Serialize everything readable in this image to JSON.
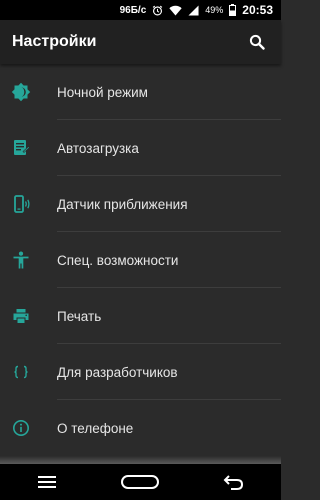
{
  "status_bar": {
    "network_speed": "96Б/с",
    "battery_percent": "49%",
    "time": "20:53"
  },
  "app_bar": {
    "title": "Настройки",
    "search_icon": "search-icon"
  },
  "accent_color": "#26a69a",
  "items": [
    {
      "label": "Ночной режим",
      "icon": "brightness-gear-icon"
    },
    {
      "label": "Автозагрузка",
      "icon": "autostart-list-icon"
    },
    {
      "label": "Датчик приближения",
      "icon": "proximity-sensor-icon"
    },
    {
      "label": "Спец. возможности",
      "icon": "accessibility-icon"
    },
    {
      "label": "Печать",
      "icon": "printer-icon"
    },
    {
      "label": "Для разработчиков",
      "icon": "developer-braces-icon"
    },
    {
      "label": "О телефоне",
      "icon": "info-icon"
    }
  ],
  "nav_bar": {
    "buttons": [
      "menu-icon",
      "home-icon",
      "back-icon"
    ]
  }
}
